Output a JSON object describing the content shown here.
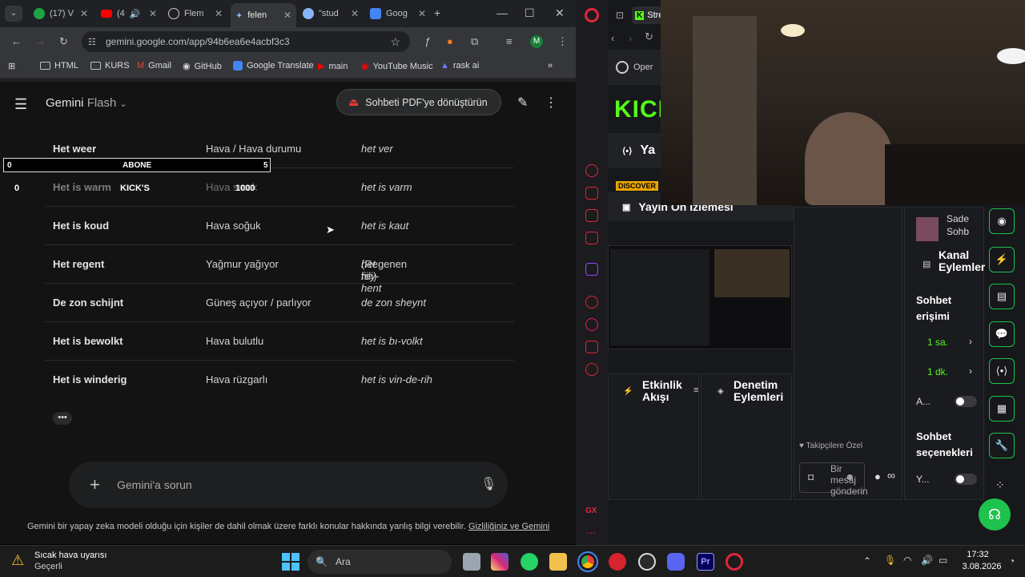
{
  "tabs": [
    {
      "label": "(17) V",
      "badge": "17"
    },
    {
      "label": "(4"
    },
    {
      "label": "Flem"
    },
    {
      "label": "felen"
    },
    {
      "label": "\"stud"
    },
    {
      "label": "Goog"
    }
  ],
  "url": "gemini.google.com/app/94b6ea6e4acbf3c3",
  "bookmarks": [
    "HTML",
    "KURS",
    "Gmail",
    "GitHub",
    "Google Translate",
    "main",
    "YouTube Music",
    "rask ai"
  ],
  "gemini": {
    "title": "Gemini",
    "model": "Flash",
    "pdf_button": "Sohbeti PDF'ye dönüştürün",
    "placeholder": "Gemini'a sorun",
    "disclaimer": "Gemini bir yapay zeka modeli olduğu için kişiler de dahil olmak üzere farklı konular hakkında yanlış bilgi verebilir.",
    "privacy_link": "Gizliliğiniz ve Gemini"
  },
  "table": [
    {
      "nl": "Het weer",
      "tr": "Hava / Hava durumu",
      "pron": "het ver",
      "note": ""
    },
    {
      "nl": "Het is warm",
      "tr": "Hava sıcak",
      "pron": "het is varm",
      "note": ""
    },
    {
      "nl": "Het is koud",
      "tr": "Hava soğuk",
      "pron": "het is kaut",
      "note": ""
    },
    {
      "nl": "Het regent",
      "tr": "Yağmur yağıyor",
      "pron": "het rey-hent",
      "note": "(Regenen fiili)"
    },
    {
      "nl": "De zon schijnt",
      "tr": "Güneş açıyor / parlıyor",
      "pron": "de zon sheynt",
      "note": ""
    },
    {
      "nl": "Het is bewolkt",
      "tr": "Hava bulutlu",
      "pron": "het is bı-volkt",
      "note": ""
    },
    {
      "nl": "Het is winderig",
      "tr": "Hava rüzgarlı",
      "pron": "het is vin-de-rih",
      "note": ""
    }
  ],
  "overlay": {
    "abone_label": "ABONE",
    "abone_left": "0",
    "abone_right": "5",
    "abone_progress": 0.0,
    "kicks_left": "0",
    "kicks_label": "KICK'S",
    "kicks_goal": "1000"
  },
  "taskbar": {
    "weather_title": "Sıcak hava uyarısı",
    "weather_sub": "Geçerli",
    "search": "Ara",
    "time": "17:32",
    "date": "3.08.2026"
  },
  "kick": {
    "tab_label": "Stre",
    "open_label": "Oper",
    "yayin": "Ya",
    "discover": "DISCOVER",
    "preview": "Yayın Ön İzlemesi",
    "activity": "Etkinlik Akışı",
    "moderation": "Denetim Eylemleri",
    "chat_title": "Sade Sohb",
    "channel_actions": "Kanal Eylemleri",
    "chat_access": "Sohbet erişimi",
    "duration1": "1 sa.",
    "duration2": "1 dk.",
    "opt_a": "A...",
    "chat_options": "Sohbet seçenekleri",
    "opt_y": "Y...",
    "followers_only": "Takipçilere Özel",
    "message_placeholder": "Bir mesaj gönderin"
  }
}
